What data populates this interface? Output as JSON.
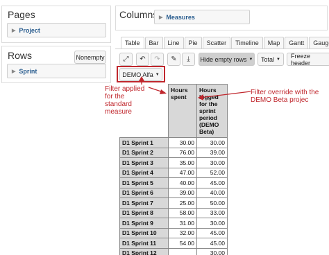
{
  "pages": {
    "title": "Pages",
    "dimension": "Project"
  },
  "rows": {
    "title": "Rows",
    "nonempty_label": "Nonempty",
    "dimension": "Sprint"
  },
  "columns": {
    "title": "Columns",
    "dimension": "Measures"
  },
  "tabs": [
    "Table",
    "Bar",
    "Line",
    "Pie",
    "Scatter",
    "Timeline",
    "Map",
    "Gantt",
    "Gauge"
  ],
  "toolbar": {
    "hide_empty_rows": "Hide empty rows",
    "total": "Total",
    "freeze_header": "Freeze header"
  },
  "filter_dropdown": "DEMO Alfa",
  "table": {
    "headers": [
      "Hours spent",
      "Hours logged for the sprint period (DEMO Beta)"
    ],
    "rows": [
      {
        "label": "D1 Sprint 1",
        "spent": "30.00",
        "logged": "30.00"
      },
      {
        "label": "D1 Sprint 2",
        "spent": "76.00",
        "logged": "39.00"
      },
      {
        "label": "D1 Sprint 3",
        "spent": "35.00",
        "logged": "30.00"
      },
      {
        "label": "D1 Sprint 4",
        "spent": "47.00",
        "logged": "52.00"
      },
      {
        "label": "D1 Sprint 5",
        "spent": "40.00",
        "logged": "45.00"
      },
      {
        "label": "D1 Sprint 6",
        "spent": "39.00",
        "logged": "40.00"
      },
      {
        "label": "D1 Sprint 7",
        "spent": "25.00",
        "logged": "50.00"
      },
      {
        "label": "D1 Sprint 8",
        "spent": "58.00",
        "logged": "33.00"
      },
      {
        "label": "D1 Sprint 9",
        "spent": "31.00",
        "logged": "30.00"
      },
      {
        "label": "D1 Sprint 10",
        "spent": "32.00",
        "logged": "45.00"
      },
      {
        "label": "D1 Sprint 11",
        "spent": "54.00",
        "logged": "45.00"
      },
      {
        "label": "D1 Sprint 12",
        "spent": "",
        "logged": "30.00"
      }
    ]
  },
  "annotations": {
    "left": "Filter applied for the standard measure",
    "right": "Filter override with the DEMO Beta projec"
  },
  "colors": {
    "annotation": "#c0272d",
    "link": "#2a5d8f",
    "header_bg": "#d8d8d8"
  }
}
